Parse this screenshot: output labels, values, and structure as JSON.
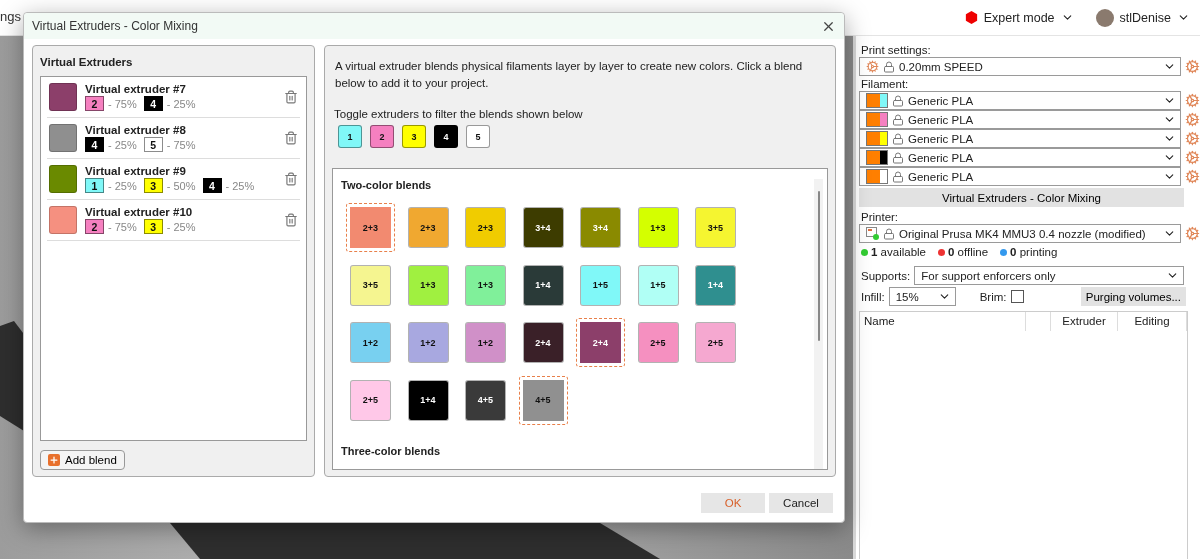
{
  "background_tab": {
    "label": "ngs"
  },
  "header": {
    "mode": "Expert mode",
    "user": "stlDenise"
  },
  "dialog": {
    "title": "Virtual Extruders - Color Mixing",
    "extruders_panel": {
      "title": "Virtual Extruders",
      "add_button": "Add blend",
      "items": [
        {
          "name": "Virtual extruder #7",
          "color": "#8c3f6a",
          "parts": [
            {
              "label": "2",
              "color": "#f580c0",
              "share": "- 75%"
            },
            {
              "label": "4",
              "color": "#000000",
              "share": "- 25%"
            }
          ]
        },
        {
          "name": "Virtual extruder #8",
          "color": "#8f8f8f",
          "parts": [
            {
              "label": "4",
              "color": "#000000",
              "share": "- 25%"
            },
            {
              "label": "5",
              "color": "#ffffff",
              "share": "- 75%"
            }
          ]
        },
        {
          "name": "Virtual extruder #9",
          "color": "#6a8a00",
          "parts": [
            {
              "label": "1",
              "color": "#80f8f8",
              "share": "- 25%"
            },
            {
              "label": "3",
              "color": "#ffff00",
              "share": "- 50%"
            },
            {
              "label": "4",
              "color": "#000000",
              "share": "- 25%"
            }
          ]
        },
        {
          "name": "Virtual extruder #10",
          "color": "#f59080",
          "parts": [
            {
              "label": "2",
              "color": "#f580c0",
              "share": "- 75%"
            },
            {
              "label": "3",
              "color": "#ffff00",
              "share": "- 25%"
            }
          ]
        }
      ]
    },
    "blends_panel": {
      "description": "A virtual extruder blends physical filaments layer by layer to create new colors. Click a blend below to add it to your project.",
      "toggle_label": "Toggle extruders to filter the blends shown below",
      "toggles": [
        {
          "label": "1",
          "color": "#80f8f8"
        },
        {
          "label": "2",
          "color": "#f580c0"
        },
        {
          "label": "3",
          "color": "#ffff00"
        },
        {
          "label": "4",
          "color": "#000000"
        },
        {
          "label": "5",
          "color": "#ffffff"
        }
      ],
      "sections": [
        {
          "title": "Two-color blends",
          "blends": [
            {
              "label": "2+3",
              "color": "#f28a70",
              "selected": true
            },
            {
              "label": "2+3",
              "color": "#f0a830",
              "selected": false
            },
            {
              "label": "2+3",
              "color": "#f0cc00",
              "selected": false
            },
            {
              "label": "3+4",
              "color": "#3d3c00",
              "selected": false
            },
            {
              "label": "3+4",
              "color": "#8a8a00",
              "selected": false
            },
            {
              "label": "1+3",
              "color": "#d4ff00",
              "selected": false
            },
            {
              "label": "3+5",
              "color": "#f5f530",
              "selected": false
            },
            {
              "label": "3+5",
              "color": "#f5f590",
              "selected": false
            },
            {
              "label": "1+3",
              "color": "#a0f040",
              "selected": false
            },
            {
              "label": "1+3",
              "color": "#80f09a",
              "selected": false
            },
            {
              "label": "1+4",
              "color": "#2a3a38",
              "selected": false
            },
            {
              "label": "1+5",
              "color": "#80f8f8",
              "selected": false
            },
            {
              "label": "1+5",
              "color": "#b0fff5",
              "selected": false
            },
            {
              "label": "1+4",
              "color": "#2f8f8f",
              "selected": false
            },
            {
              "label": "1+2",
              "color": "#78d0f0",
              "selected": false
            },
            {
              "label": "1+2",
              "color": "#a8a8e0",
              "selected": false
            },
            {
              "label": "1+2",
              "color": "#d090c8",
              "selected": false
            },
            {
              "label": "2+4",
              "color": "#3a2028",
              "selected": false
            },
            {
              "label": "2+4",
              "color": "#8c3f6a",
              "selected": true
            },
            {
              "label": "2+5",
              "color": "#f590c0",
              "selected": false
            },
            {
              "label": "2+5",
              "color": "#f5a8d0",
              "selected": false
            },
            {
              "label": "2+5",
              "color": "#ffc8e8",
              "selected": false
            },
            {
              "label": "1+4",
              "color": "#000000",
              "selected": false
            },
            {
              "label": "4+5",
              "color": "#3a3a3a",
              "selected": false
            },
            {
              "label": "4+5",
              "color": "#909090",
              "selected": true
            }
          ]
        },
        {
          "title": "Three-color blends"
        }
      ]
    },
    "buttons": [
      {
        "label": "OK",
        "kind": "primary"
      },
      {
        "label": "Cancel",
        "kind": "secondary"
      }
    ]
  },
  "sidebar": {
    "print_settings": {
      "label": "Print settings:",
      "value": "0.20mm SPEED"
    },
    "filament": {
      "label": "Filament:",
      "items": [
        {
          "name": "Generic PLA",
          "color": "#80f8f8"
        },
        {
          "name": "Generic PLA",
          "color": "#f580c0"
        },
        {
          "name": "Generic PLA",
          "color": "#ffff00"
        },
        {
          "name": "Generic PLA",
          "color": "#000000"
        },
        {
          "name": "Generic PLA",
          "color": "#ffffff"
        }
      ]
    },
    "mixing_button": "Virtual Extruders - Color Mixing",
    "printer": {
      "label": "Printer:",
      "value": "Original Prusa MK4 MMU3 0.4 nozzle (modified)"
    },
    "printer_status": [
      {
        "text": "**1** available",
        "color": "#33cc33"
      },
      {
        "text": "**0** offline",
        "color": "#ee3333"
      },
      {
        "text": "**0** printing",
        "color": "#3399ee"
      }
    ],
    "supports": {
      "label": "Supports:",
      "value": "For support enforcers only"
    },
    "infill": {
      "label": "Infill:",
      "value": "15%"
    },
    "brim": {
      "label": "Brim:",
      "checked": false
    },
    "purging_button": "Purging volumes...",
    "object_list": {
      "columns": [
        {
          "label": "Name"
        },
        {
          "label": "Extruder"
        },
        {
          "label": "Editing"
        }
      ]
    }
  }
}
